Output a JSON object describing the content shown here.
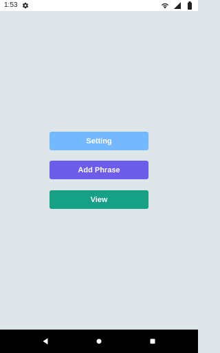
{
  "status_bar": {
    "time": "1:53",
    "left_icons": [
      "gear-icon"
    ],
    "right_icons": [
      "wifi-icon",
      "signal-icon",
      "battery-icon"
    ]
  },
  "main": {
    "buttons": [
      {
        "label": "Setting",
        "color": "#74b9ff"
      },
      {
        "label": "Add Phrase",
        "color": "#6c5ce7"
      },
      {
        "label": "View",
        "color": "#16a085"
      }
    ]
  },
  "nav_bar": {
    "buttons": [
      "back-icon",
      "home-icon",
      "recents-icon"
    ]
  },
  "colors": {
    "background": "#dfe6e9",
    "status_bar": "#ffffff",
    "nav_bar": "#000000"
  }
}
